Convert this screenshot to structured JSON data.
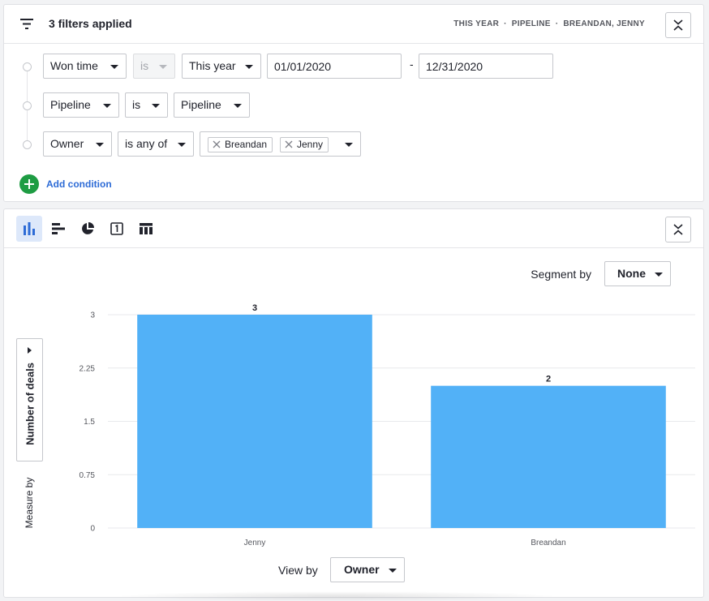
{
  "filters": {
    "title": "3 filters applied",
    "summary": [
      "THIS YEAR",
      "PIPELINE",
      "BREANDAN, JENNY"
    ],
    "summary_sep": "·",
    "conditions": [
      {
        "field": "Won time",
        "operator": "is",
        "value": "This year",
        "date_from": "01/01/2020",
        "date_to": "12/31/2020",
        "range_sep": "-"
      },
      {
        "field": "Pipeline",
        "operator": "is",
        "value": "Pipeline"
      },
      {
        "field": "Owner",
        "operator": "is any of",
        "tags": [
          "Breandan",
          "Jenny"
        ]
      }
    ],
    "add_condition": "Add condition"
  },
  "toolbar": {
    "icons": [
      "vertical-bar-chart-icon",
      "horizontal-bar-chart-icon",
      "pie-chart-icon",
      "scorecard-icon",
      "table-icon"
    ],
    "active": "vertical-bar-chart-icon"
  },
  "segment": {
    "label": "Segment by",
    "value": "None"
  },
  "measure": {
    "label": "Measure by",
    "value": "Number of deals"
  },
  "viewby": {
    "label": "View by",
    "value": "Owner"
  },
  "colors": {
    "bar": "#52b1f7",
    "accent": "#2d6bd6",
    "add": "#1e9c43"
  },
  "chart_data": {
    "type": "bar",
    "categories": [
      "Jenny",
      "Breandan"
    ],
    "values": [
      3,
      2
    ],
    "value_labels": [
      "3",
      "2"
    ],
    "yticks": [
      "0",
      "0.75",
      "1.5",
      "2.25",
      "3"
    ],
    "ylim": [
      0,
      3
    ],
    "grid": true,
    "xlabel": "",
    "ylabel": ""
  }
}
